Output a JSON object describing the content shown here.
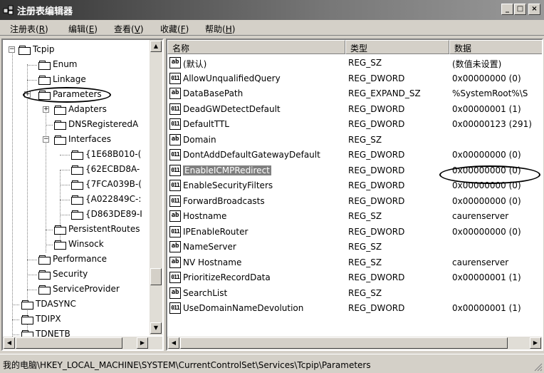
{
  "window": {
    "title": "注册表编辑器",
    "controls": [
      "_",
      "□",
      "×"
    ]
  },
  "menu": [
    {
      "label": "注册表(",
      "key": "R",
      "suffix": ")"
    },
    {
      "label": "编辑(",
      "key": "E",
      "suffix": ")"
    },
    {
      "label": "查看(",
      "key": "V",
      "suffix": ")"
    },
    {
      "label": "收藏(",
      "key": "F",
      "suffix": ")"
    },
    {
      "label": "帮助(",
      "key": "H",
      "suffix": ")"
    }
  ],
  "tree": {
    "items": [
      {
        "label": "Tcpip",
        "expander": "−"
      },
      {
        "label": "Enum"
      },
      {
        "label": "Linkage"
      },
      {
        "label": "Parameters",
        "highlighted": true
      },
      {
        "label": "Adapters",
        "expander": "+"
      },
      {
        "label": "DNSRegisteredA"
      },
      {
        "label": "Interfaces",
        "expander": "−"
      },
      {
        "label": "{1E68B010-("
      },
      {
        "label": "{62ECBD8A-"
      },
      {
        "label": "{7FCA039B-("
      },
      {
        "label": "{A022849C-:"
      },
      {
        "label": "{D863DE89-I"
      },
      {
        "label": "PersistentRoutes"
      },
      {
        "label": "Winsock"
      },
      {
        "label": "Performance"
      },
      {
        "label": "Security"
      },
      {
        "label": "ServiceProvider"
      },
      {
        "label": "TDASYNC"
      },
      {
        "label": "TDIPX"
      },
      {
        "label": "TDNETB"
      }
    ]
  },
  "list": {
    "columns": [
      "名称",
      "类型",
      "数据"
    ],
    "rows": [
      {
        "icon": "ab",
        "name": "(默认)",
        "type": "REG_SZ",
        "data": "(数值未设置)"
      },
      {
        "icon": "bin",
        "name": "AllowUnqualifiedQuery",
        "type": "REG_DWORD",
        "data": "0x00000000 (0)"
      },
      {
        "icon": "ab",
        "name": "DataBasePath",
        "type": "REG_EXPAND_SZ",
        "data": "%SystemRoot%\\S"
      },
      {
        "icon": "bin",
        "name": "DeadGWDetectDefault",
        "type": "REG_DWORD",
        "data": "0x00000001 (1)"
      },
      {
        "icon": "bin",
        "name": "DefaultTTL",
        "type": "REG_DWORD",
        "data": "0x00000123 (291)"
      },
      {
        "icon": "ab",
        "name": "Domain",
        "type": "REG_SZ",
        "data": ""
      },
      {
        "icon": "bin",
        "name": "DontAddDefaultGatewayDefault",
        "type": "REG_DWORD",
        "data": "0x00000000 (0)"
      },
      {
        "icon": "bin",
        "name": "EnableICMPRedirect",
        "type": "REG_DWORD",
        "data": "0x00000000 (0)",
        "highlighted": true
      },
      {
        "icon": "bin",
        "name": "EnableSecurityFilters",
        "type": "REG_DWORD",
        "data": "0x00000000 (0)"
      },
      {
        "icon": "bin",
        "name": "ForwardBroadcasts",
        "type": "REG_DWORD",
        "data": "0x00000000 (0)"
      },
      {
        "icon": "ab",
        "name": "Hostname",
        "type": "REG_SZ",
        "data": "caurenserver"
      },
      {
        "icon": "bin",
        "name": "IPEnableRouter",
        "type": "REG_DWORD",
        "data": "0x00000000 (0)"
      },
      {
        "icon": "ab",
        "name": "NameServer",
        "type": "REG_SZ",
        "data": ""
      },
      {
        "icon": "ab",
        "name": "NV Hostname",
        "type": "REG_SZ",
        "data": "caurenserver"
      },
      {
        "icon": "bin",
        "name": "PrioritizeRecordData",
        "type": "REG_DWORD",
        "data": "0x00000001 (1)"
      },
      {
        "icon": "ab",
        "name": "SearchList",
        "type": "REG_SZ",
        "data": ""
      },
      {
        "icon": "bin",
        "name": "UseDomainNameDevolution",
        "type": "REG_DWORD",
        "data": "0x00000001 (1)"
      }
    ]
  },
  "icons": {
    "ab": "ab",
    "bin": "011"
  },
  "status": {
    "path": "我的电脑\\HKEY_LOCAL_MACHINE\\SYSTEM\\CurrentControlSet\\Services\\Tcpip\\Parameters"
  }
}
